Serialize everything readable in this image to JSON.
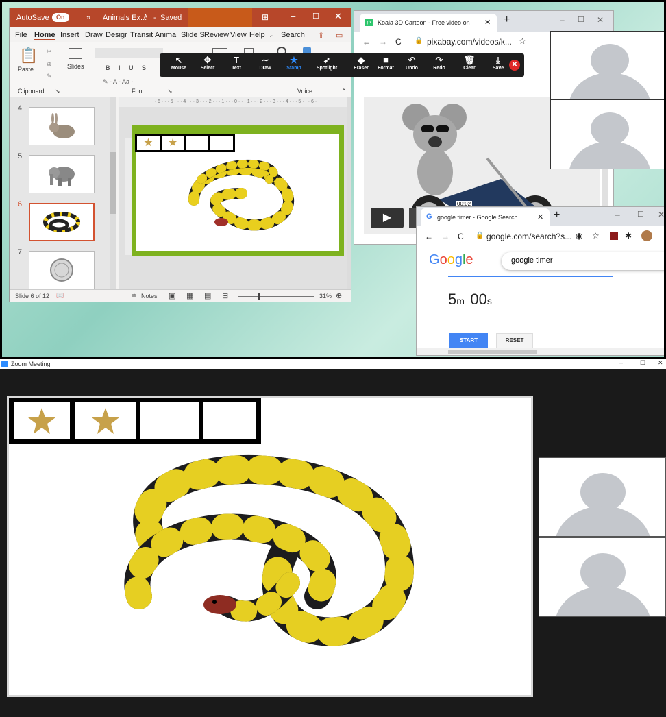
{
  "ppt": {
    "autosave_label": "AutoSave",
    "autosave_state": "On",
    "doc_title": "Animals Ex...",
    "saved_status": "Saved",
    "menu": [
      "File",
      "Home",
      "Insert",
      "Draw",
      "Design",
      "Transitions",
      "Animations",
      "Slide Show",
      "Review",
      "View",
      "Help"
    ],
    "menu_display": [
      "File",
      "Home",
      "Insert",
      "Draw",
      "Desigr",
      "Transit",
      "Anima",
      "Slide S",
      "Review",
      "View",
      "Help"
    ],
    "search_label": "Search",
    "ribbon": {
      "paste": "Paste",
      "slides": "Slides",
      "clipboard": "Clipboard",
      "font": "Font",
      "voice": "Voice"
    },
    "slide_numbers": [
      "4",
      "5",
      "6",
      "7"
    ],
    "thumb_icons": [
      "rabbit",
      "elephant",
      "snake",
      "coin"
    ],
    "status_slide": "Slide 6 of 12",
    "notes": "Notes",
    "zoom_level": "31%"
  },
  "annotate": {
    "tools": [
      "Mouse",
      "Select",
      "Text",
      "Draw",
      "Stamp",
      "Spotlight",
      "Eraser",
      "Format",
      "Undo",
      "Redo",
      "Clear",
      "Save"
    ],
    "active_tool": "Stamp"
  },
  "koala_browser": {
    "tab_title": "Koala 3D Cartoon - Free video on",
    "url": "pixabay.com/videos/k...",
    "video_time": "00:02"
  },
  "google_browser": {
    "tab_title": "google timer - Google Search",
    "url": "google.com/search?s...",
    "search_text": "google timer",
    "logo": "Google",
    "timer_minutes": "5",
    "timer_min_unit": "m",
    "timer_seconds": "00",
    "timer_sec_unit": "s",
    "start_label": "START",
    "reset_label": "RESET"
  },
  "zoom": {
    "title": "Zoom Meeting",
    "stars": {
      "earned": 2,
      "total": 4
    }
  },
  "colors": {
    "ppt_red": "#b7472a",
    "slide_green": "#7eb21f",
    "star_gold": "#c7a14a",
    "google_blue": "#4285f4"
  }
}
